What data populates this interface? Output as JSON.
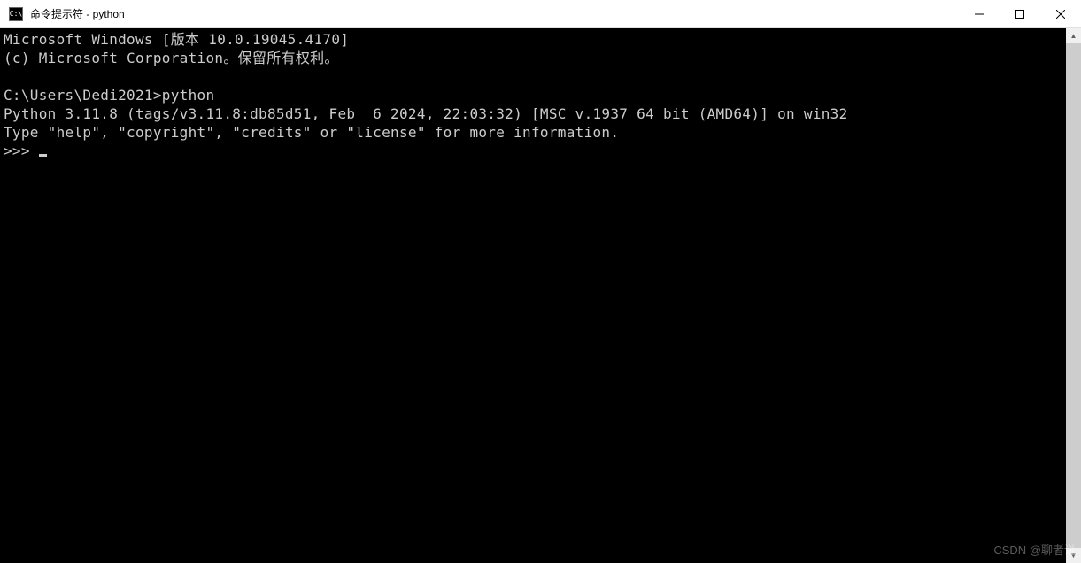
{
  "window": {
    "title": "命令提示符 - python",
    "icon_label": "C:\\"
  },
  "terminal": {
    "lines": {
      "l0": "Microsoft Windows [版本 10.0.19045.4170]",
      "l1": "(c) Microsoft Corporation。保留所有权利。",
      "l2": "",
      "l3": "C:\\Users\\Dedi2021>python",
      "l4": "Python 3.11.8 (tags/v3.11.8:db85d51, Feb  6 2024, 22:03:32) [MSC v.1937 64 bit (AMD64)] on win32",
      "l5": "Type \"help\", \"copyright\", \"credits\" or \"license\" for more information.",
      "l6": ">>> "
    }
  },
  "watermark": "CSDN @聊者说"
}
